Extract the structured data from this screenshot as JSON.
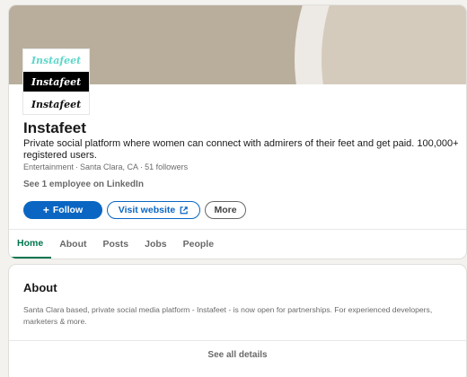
{
  "company": {
    "logo_lines": [
      "Instafeet",
      "Instafeet",
      "Instafeet"
    ],
    "name": "Instafeet",
    "tagline": "Private social platform where women can connect with admirers of their feet and get paid. 100,000+ registered users.",
    "industry": "Entertainment",
    "location": "Santa Clara, CA",
    "followers": "51 followers",
    "meta_separator": "·",
    "employees_link": "See 1 employee on LinkedIn"
  },
  "actions": {
    "follow_label": "Follow",
    "follow_icon": "plus-icon",
    "visit_label": "Visit website",
    "visit_icon": "external-link-icon",
    "more_label": "More"
  },
  "tabs": [
    {
      "label": "Home",
      "active": true
    },
    {
      "label": "About",
      "active": false
    },
    {
      "label": "Posts",
      "active": false
    },
    {
      "label": "Jobs",
      "active": false
    },
    {
      "label": "People",
      "active": false
    }
  ],
  "about": {
    "title": "About",
    "text": "Santa Clara based, private social media platform - Instafeet - is now open for partnerships. For experienced developers, marketers & more.",
    "see_all": "See all details"
  },
  "colors": {
    "primary_blue": "#0a66c2",
    "active_tab_green": "#01754f",
    "banner": "#b9ae9c",
    "logo_teal": "#5fd6c9"
  }
}
